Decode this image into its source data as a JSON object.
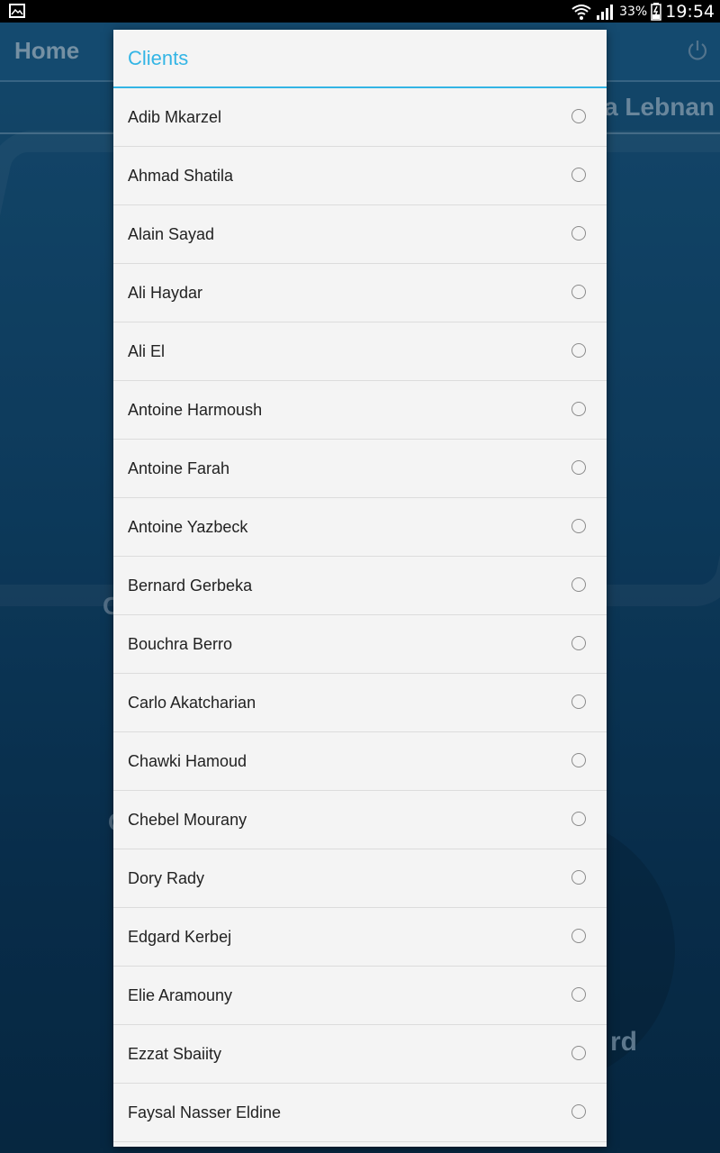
{
  "status_bar": {
    "battery": "33%",
    "time": "19:54",
    "icons": [
      "gallery-icon",
      "wifi-icon",
      "signal-icon",
      "battery-charging-icon"
    ]
  },
  "background_app": {
    "title": "Home",
    "subtitle": "a Lebnan",
    "partial_text_right": "rd",
    "partial_letter_1": "C",
    "partial_letter_2": "C",
    "icons": [
      "power-icon"
    ]
  },
  "dialog": {
    "title": "Clients",
    "accent_color": "#33b5e5",
    "items": [
      {
        "label": "Adib Mkarzel"
      },
      {
        "label": "Ahmad Shatila"
      },
      {
        "label": "Alain Sayad"
      },
      {
        "label": "Ali Haydar"
      },
      {
        "label": "Ali El"
      },
      {
        "label": "Antoine Harmoush"
      },
      {
        "label": "Antoine Farah"
      },
      {
        "label": "Antoine Yazbeck"
      },
      {
        "label": "Bernard Gerbeka"
      },
      {
        "label": "Bouchra Berro"
      },
      {
        "label": "Carlo Akatcharian"
      },
      {
        "label": "Chawki Hamoud"
      },
      {
        "label": "Chebel Mourany"
      },
      {
        "label": "Dory Rady"
      },
      {
        "label": "Edgard Kerbej"
      },
      {
        "label": "Elie Aramouny"
      },
      {
        "label": "Ezzat Sbaiity"
      },
      {
        "label": "Faysal Nasser Eldine"
      }
    ]
  }
}
